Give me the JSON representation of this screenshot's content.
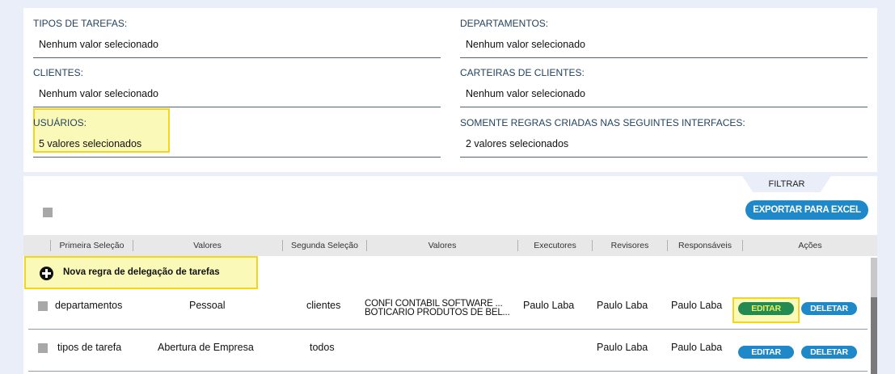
{
  "filters": {
    "tipos_de_tarefas": {
      "label": "TIPOS DE TAREFAS:",
      "value": "Nenhum valor selecionado"
    },
    "departamentos": {
      "label": "DEPARTAMENTOS:",
      "value": "Nenhum valor selecionado"
    },
    "clientes": {
      "label": "CLIENTES:",
      "value": "Nenhum valor selecionado"
    },
    "carteiras_de_clientes": {
      "label": "CARTEIRAS DE CLIENTES:",
      "value": "Nenhum valor selecionado"
    },
    "usuarios": {
      "label": "USUÁRIOS:",
      "value": "5 valores selecionados"
    },
    "somente_regras": {
      "label": "SOMENTE REGRAS CRIADAS NAS SEGUINTES INTERFACES:",
      "value": "2 valores selecionados"
    }
  },
  "toolbar": {
    "filtrar_label": "FILTRAR",
    "export_label": "EXPORTAR PARA EXCEL"
  },
  "table": {
    "columns": [
      "Primeira Seleção",
      "Valores",
      "Segunda Seleção",
      "Valores",
      "Executores",
      "Revisores",
      "Responsáveis",
      "Ações"
    ],
    "new_rule_label": "Nova regra de delegação de tarefas",
    "rows": [
      {
        "primeira_selecao": "departamentos",
        "valores_1": "Pessoal",
        "segunda_selecao": "clientes",
        "valores_2": [
          "CONFI CONTABIL SOFTWARE ...",
          "BOTICARIO PRODUTOS DE BEL..."
        ],
        "executores": "Paulo Laba",
        "revisores": "Paulo Laba",
        "responsaveis": "Paulo Laba",
        "edit_label": "EDITAR",
        "delete_label": "DELETAR"
      },
      {
        "primeira_selecao": "tipos de tarefa",
        "valores_1": "Abertura de Empresa",
        "segunda_selecao": "todos",
        "valores_2": [],
        "executores": "",
        "revisores": "Paulo Laba",
        "responsaveis": "Paulo Laba",
        "edit_label": "EDITAR",
        "delete_label": "DELETAR"
      }
    ]
  },
  "colors": {
    "page_background": "#eaeef9",
    "primary_button": "#1e88c8",
    "highlight_fill": "#fbf9b8",
    "highlight_border": "#f2d51c",
    "active_edit_button": "#238a52",
    "label_text": "#1f3f5c"
  }
}
